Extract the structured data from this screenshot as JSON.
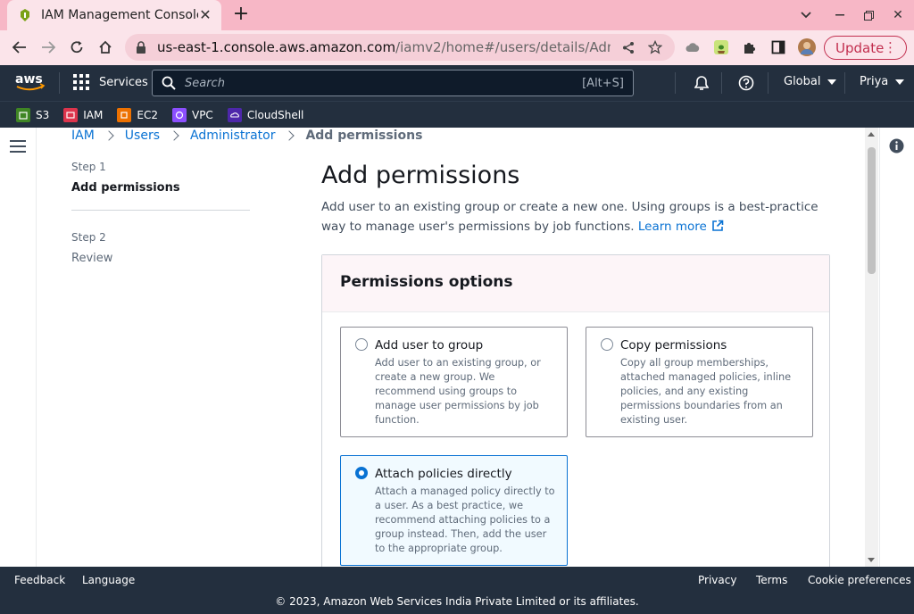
{
  "browser": {
    "tab_title": "IAM Management Console",
    "url_host": "us-east-1.console.aws.amazon.com",
    "url_path": "/iamv2/home#/users/details/Admi...",
    "update_label": "Update"
  },
  "aws_nav": {
    "services_label": "Services",
    "search_placeholder": "Search",
    "search_shortcut": "[Alt+S]",
    "region_label": "Global",
    "user_label": "Priya"
  },
  "favorites": [
    {
      "label": "S3",
      "color": "#3f8624"
    },
    {
      "label": "IAM",
      "color": "#dd344c"
    },
    {
      "label": "EC2",
      "color": "#ed7100"
    },
    {
      "label": "VPC",
      "color": "#8c4fff"
    },
    {
      "label": "CloudShell",
      "color": "#4d27aa"
    }
  ],
  "breadcrumb": {
    "items": [
      "IAM",
      "Users",
      "Administrator"
    ],
    "current": "Add permissions"
  },
  "steps": [
    {
      "num": "Step 1",
      "title": "Add permissions"
    },
    {
      "num": "Step 2",
      "title": "Review"
    }
  ],
  "page": {
    "title": "Add permissions",
    "description": "Add user to an existing group or create a new one. Using groups is a best-practice way to manage user's permissions by job functions.",
    "learn_more": "Learn more"
  },
  "panel": {
    "title": "Permissions options",
    "options": [
      {
        "title": "Add user to group",
        "desc": "Add user to an existing group, or create a new group. We recommend using groups to manage user permissions by job function.",
        "selected": false
      },
      {
        "title": "Copy permissions",
        "desc": "Copy all group memberships, attached managed policies, inline policies, and any existing permissions boundaries from an existing user.",
        "selected": false
      },
      {
        "title": "Attach policies directly",
        "desc": "Attach a managed policy directly to a user. As a best practice, we recommend attaching policies to a group instead. Then, add the user to the appropriate group.",
        "selected": true
      }
    ]
  },
  "footer": {
    "feedback": "Feedback",
    "language": "Language",
    "privacy": "Privacy",
    "terms": "Terms",
    "cookies": "Cookie preferences",
    "copyright": "© 2023, Amazon Web Services India Private Limited or its affiliates."
  },
  "colors": {
    "accent": "#0972d3",
    "nav_bg": "#232f3e",
    "browser_frame": "#f7b7c6"
  }
}
